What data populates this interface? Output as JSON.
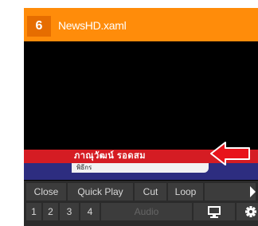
{
  "panel": {
    "channel_number": "6",
    "title": "NewsHD.xaml"
  },
  "preview": {
    "lower_third_main": "ภาณุวัฒน์ รอดสม",
    "lower_third_sub": "พิธีกร"
  },
  "controls": {
    "close_label": "Close",
    "quick_play_label": "Quick Play",
    "cut_label": "Cut",
    "loop_label": "Loop",
    "layers": [
      "1",
      "2",
      "3",
      "4"
    ],
    "audio_label": "Audio"
  },
  "colors": {
    "title_bar": "#ff8c0a",
    "badge": "#e66d00",
    "lower_third_red": "#d51c23",
    "lower_third_blue": "#2d2d80",
    "arrow_red": "#e8141b"
  },
  "icons": {
    "play": "play-icon",
    "monitor": "monitor-icon",
    "settings": "gear-icon"
  }
}
